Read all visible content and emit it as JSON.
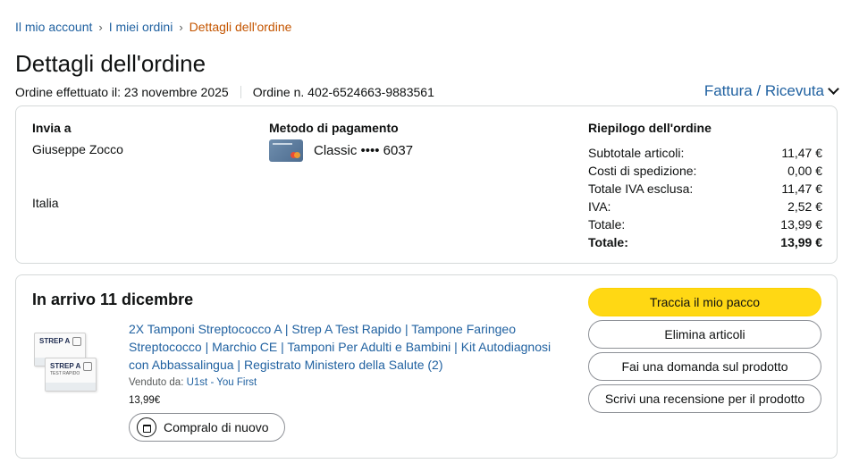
{
  "breadcrumb": {
    "items": [
      "Il mio account",
      "I miei ordini"
    ],
    "current": "Dettagli dell'ordine",
    "separator": "›"
  },
  "page_title": "Dettagli dell'ordine",
  "order_meta": {
    "date": "Ordine effettuato il: 23 novembre 2025",
    "number": "Ordine n. 402-6524663-9883561"
  },
  "invoice_link": "Fattura / Ricevuta",
  "shipping": {
    "header": "Invia a",
    "name": "Giuseppe Zocco",
    "country": "Italia"
  },
  "payment": {
    "header": "Metodo di pagamento",
    "card": "Classic •••• 6037"
  },
  "summary": {
    "header": "Riepilogo dell'ordine",
    "rows": [
      {
        "label": "Subtotale articoli:",
        "value": "11,47 €"
      },
      {
        "label": "Costi di spedizione:",
        "value": "0,00 €"
      },
      {
        "label": "Totale IVA esclusa:",
        "value": "11,47 €"
      },
      {
        "label": "IVA:",
        "value": "2,52 €"
      },
      {
        "label": "Totale:",
        "value": "13,99 €"
      },
      {
        "label": "Totale:",
        "value": "13,99 €"
      }
    ]
  },
  "shipment": {
    "title": "In arrivo 11 dicembre",
    "product_title": "2X Tamponi Streptococco A | Strep A Test Rapido | Tampone Faringeo Streptococco | Marchio CE | Tamponi Per Adulti e Bambini | Kit Autodiagnosi con Abbassalingua | Registrato Ministero della Salute (2)",
    "sold_by_label": "Venduto da:",
    "seller": "U1st - You First",
    "price": "13,99€",
    "buy_again": "Compralo di nuovo",
    "package_label": "STREP A",
    "package_sub": "TEST RAPIDO"
  },
  "actions": {
    "track": "Traccia il mio pacco",
    "delete": "Elimina articoli",
    "ask": "Fai una domanda sul prodotto",
    "review": "Scrivi una recensione per il prodotto"
  },
  "colors": {
    "link": "#2162a1",
    "current_crumb": "#c45500",
    "primary_button": "#ffd814",
    "border": "#d5d9d9"
  }
}
